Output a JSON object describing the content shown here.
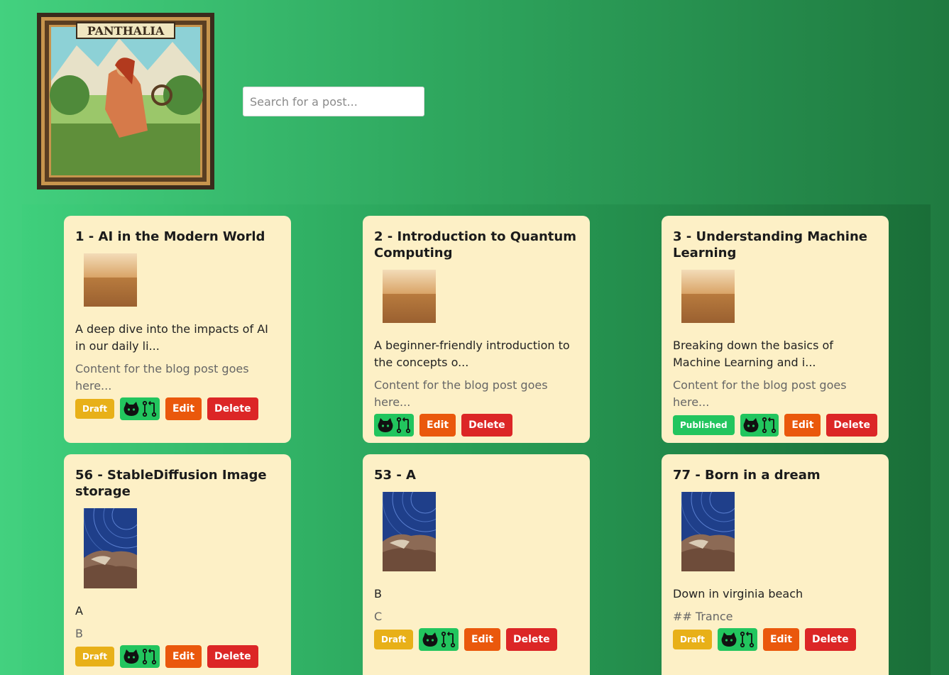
{
  "header": {
    "logo_text": "PANTHALIA",
    "search_placeholder": "Search for a post..."
  },
  "colors": {
    "draft": "#e8b018",
    "published": "#22c55e",
    "edit": "#ea580c",
    "delete": "#dc2626",
    "card": "#fdf0c6"
  },
  "posts": [
    {
      "title": "1 - AI in the Modern World",
      "image": "desert",
      "excerpt": "A deep dive into the impacts of AI in our daily li...",
      "content": "Content for the blog post goes here...",
      "status": "Draft",
      "edit": "Edit",
      "delete": "Delete"
    },
    {
      "title": "2 - Introduction to Quantum Computing",
      "image": "desert",
      "excerpt": "A beginner-friendly introduction to the concepts o...",
      "content": "Content for the blog post goes here...",
      "status": "",
      "edit": "Edit",
      "delete": "Delete"
    },
    {
      "title": "3 - Understanding Machine Learning",
      "image": "desert",
      "excerpt": "Breaking down the basics of Machine Learning and i...",
      "content": "Content for the blog post goes here...",
      "status": "Published",
      "edit": "Edit",
      "delete": "Delete"
    },
    {
      "title": "56 - StableDiffusion Image storage",
      "image": "startrails",
      "excerpt": "A",
      "content": "B",
      "status": "Draft",
      "edit": "Edit",
      "delete": "Delete"
    },
    {
      "title": "53 - A",
      "image": "startrails",
      "excerpt": "B",
      "content": "C",
      "status": "Draft",
      "edit": "Edit",
      "delete": "Delete"
    },
    {
      "title": "77 - Born in a dream",
      "image": "startrails",
      "excerpt": "Down in virginia beach",
      "content": "## Trance",
      "status": "Draft",
      "edit": "Edit",
      "delete": "Delete"
    }
  ]
}
